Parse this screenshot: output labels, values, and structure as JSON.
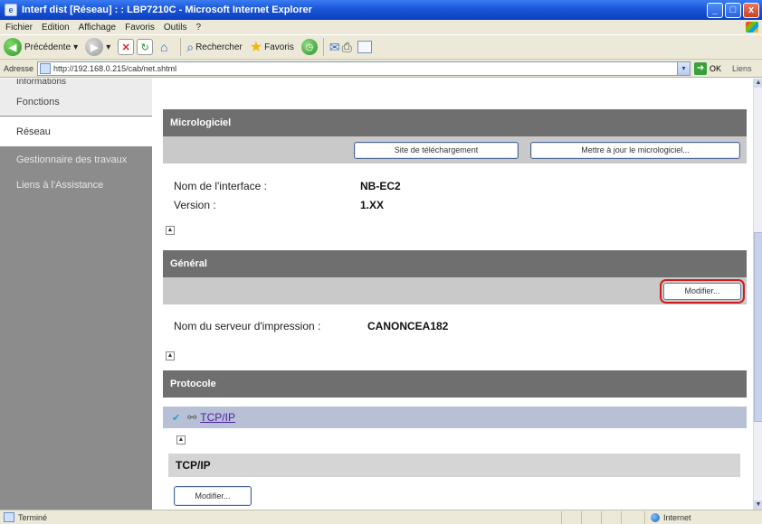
{
  "window": {
    "title": "Interf dist [Réseau] : : LBP7210C - Microsoft Internet Explorer",
    "app_icon": "e",
    "min": "_",
    "max": "□",
    "close": "x"
  },
  "menu": [
    "Fichier",
    "Edition",
    "Affichage",
    "Favoris",
    "Outils",
    "?"
  ],
  "toolbar": {
    "back": "Précédente",
    "back_dropdown": "▾",
    "search": "Rechercher",
    "favorites": "Favoris"
  },
  "address": {
    "label": "Adresse",
    "url": "http://192.168.0.215/cab/net.shtml",
    "go": "OK",
    "links": "Liens"
  },
  "sidebar": {
    "items": [
      {
        "label": "Informations"
      },
      {
        "label": "Fonctions"
      },
      {
        "label": "Réseau"
      },
      {
        "label": "Gestionnaire des travaux"
      },
      {
        "label": "Liens à l'Assistance"
      }
    ]
  },
  "firmware": {
    "title": "Micrologiciel",
    "download_button": "Site de téléchargement",
    "update_button": "Mettre à jour le micrologiciel...",
    "interface_label": "Nom de l'interface :",
    "interface_value": "NB-EC2",
    "version_label": "Version :",
    "version_value": "1.XX"
  },
  "general": {
    "title": "Général",
    "modify_button": "Modifier...",
    "server_label": "Nom du serveur d'impression :",
    "server_value": "CANONCEA182"
  },
  "protocol": {
    "title": "Protocole",
    "item": "TCP/IP",
    "subsection_title": "TCP/IP",
    "modify_button": "Modifier..."
  },
  "status": {
    "text": "Terminé",
    "zone": "Internet"
  },
  "colors": {
    "section_bar": "#6f6f6f",
    "selected_outline": "#d01e1e",
    "link": "#4b1fa1"
  }
}
